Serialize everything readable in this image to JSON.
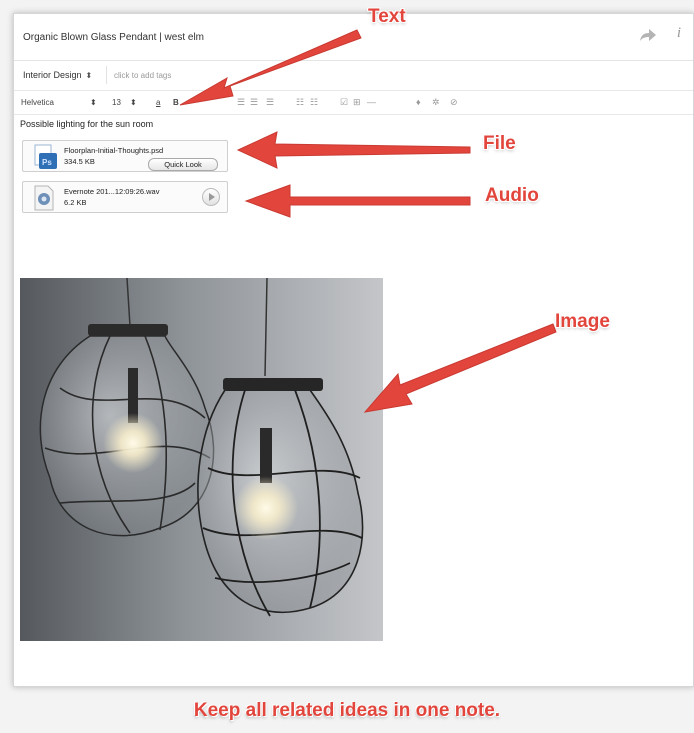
{
  "note": {
    "title": "Organic Blown Glass Pendant | west elm",
    "notebook": "Interior Design",
    "notebook_arrows": "⬍",
    "tags_placeholder": "click to add tags",
    "body_text": "Possible lighting for the sun room"
  },
  "toolbar": {
    "font": "Helvetica",
    "font_arrows": "⬍",
    "size": "13",
    "size_arrows": "⬍",
    "color": "a",
    "bold": "B"
  },
  "attachments": [
    {
      "type": "file",
      "name": "Floorplan-Initial-Thoughts.psd",
      "size": "334.5 KB",
      "action": "Quick Look",
      "icon": "psd-file-icon"
    },
    {
      "type": "audio",
      "name": "Evernote 201...12:09:26.wav",
      "size": "6.2 KB",
      "icon": "audio-file-icon"
    }
  ],
  "image": {
    "subject": "two blown glass pendant lamps",
    "icon": "photo"
  },
  "callouts": {
    "text": "Text",
    "file": "File",
    "audio": "Audio",
    "image": "Image"
  },
  "footer": "Keep all related ideas in one note.",
  "colors": {
    "callout": "#e2453c",
    "ps_blue": "#2f6fb5"
  }
}
